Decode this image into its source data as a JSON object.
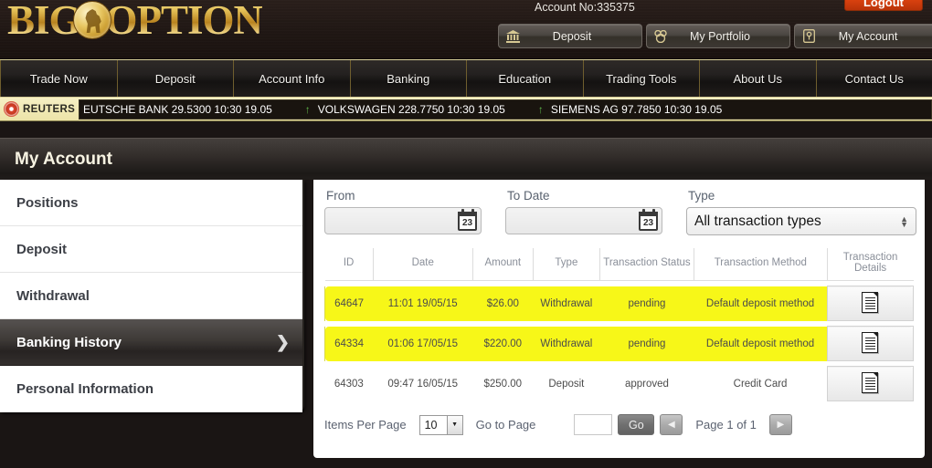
{
  "header": {
    "logo_text_1": "BIG",
    "logo_text_2": "OPTION",
    "account_no": "Account No:335375",
    "logout_label": "Logout",
    "buttons": [
      {
        "label": "Deposit",
        "icon": "bank-icon",
        "glyph": "⌂"
      },
      {
        "label": "My Portfolio",
        "icon": "people-icon",
        "glyph": "⚬"
      },
      {
        "label": "My Account",
        "icon": "key-icon",
        "glyph": "⚿"
      }
    ]
  },
  "nav": {
    "items": [
      {
        "label": "Trade Now"
      },
      {
        "label": "Deposit"
      },
      {
        "label": "Account Info"
      },
      {
        "label": "Banking"
      },
      {
        "label": "Education"
      },
      {
        "label": "Trading Tools"
      },
      {
        "label": "About Us"
      },
      {
        "label": "Contact Us"
      }
    ]
  },
  "ticker": {
    "brand": "REUTERS",
    "quotes": [
      {
        "arrow": "",
        "text": "EUTSCHE BANK 29.5300 10:30 19.05"
      },
      {
        "arrow": "↑",
        "text": "VOLKSWAGEN 228.7750 10:30 19.05"
      },
      {
        "arrow": "↑",
        "text": "SIEMENS AG 97.7850 10:30 19.05"
      }
    ]
  },
  "page": {
    "title": "My Account"
  },
  "sidebar": {
    "items": [
      {
        "label": "Positions",
        "active": false
      },
      {
        "label": "Deposit",
        "active": false
      },
      {
        "label": "Withdrawal",
        "active": false
      },
      {
        "label": "Banking History",
        "active": true
      },
      {
        "label": "Personal Information",
        "active": false
      }
    ],
    "active_chevron": "❯"
  },
  "filters": {
    "from_label": "From",
    "from_value": "",
    "to_label": "To Date",
    "to_value": "",
    "calendar_day": "23",
    "type_label": "Type",
    "type_value": "All transaction types"
  },
  "table": {
    "columns": [
      "ID",
      "Date",
      "Amount",
      "Type",
      "Transaction Status",
      "Transaction Method",
      "Transaction Details"
    ],
    "rows": [
      {
        "id": "64647",
        "date": "11:01 19/05/15",
        "amount": "$26.00",
        "type": "Withdrawal",
        "status": "pending",
        "method": "Default deposit method",
        "highlight": true
      },
      {
        "id": "64334",
        "date": "01:06 17/05/15",
        "amount": "$220.00",
        "type": "Withdrawal",
        "status": "pending",
        "method": "Default deposit method",
        "highlight": true
      },
      {
        "id": "64303",
        "date": "09:47 16/05/15",
        "amount": "$250.00",
        "type": "Deposit",
        "status": "approved",
        "method": "Credit Card",
        "highlight": false
      }
    ],
    "highlight_color": "#f7f718"
  },
  "pager": {
    "items_per_page_label": "Items Per Page",
    "items_per_page_value": "10",
    "go_to_page_label": "Go to Page",
    "go_to_page_value": "",
    "go_label": "Go",
    "prev_glyph": "◀",
    "next_glyph": "▶",
    "page_status": "Page 1 of 1"
  }
}
